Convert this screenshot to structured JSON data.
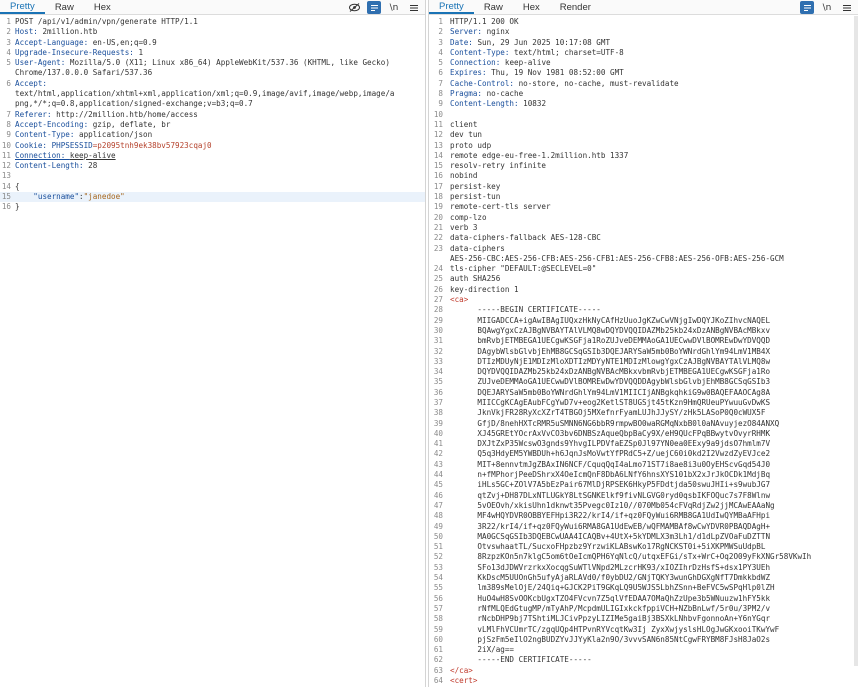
{
  "request": {
    "tabs": [
      "Pretty",
      "Raw",
      "Hex"
    ],
    "active_tab": "Pretty",
    "lines": [
      {
        "n": "1",
        "parts": [
          {
            "t": "POST /api/v1/admin/vpn/generate HTTP/1.1",
            "c": "hv"
          }
        ]
      },
      {
        "n": "2",
        "parts": [
          {
            "t": "Host: ",
            "c": "hk"
          },
          {
            "t": "2million.htb",
            "c": "hv"
          }
        ]
      },
      {
        "n": "3",
        "parts": [
          {
            "t": "Accept-Language: ",
            "c": "hk"
          },
          {
            "t": "en-US,en;q=0.9",
            "c": "hv"
          }
        ]
      },
      {
        "n": "4",
        "parts": [
          {
            "t": "Upgrade-Insecure-Requests: ",
            "c": "hk"
          },
          {
            "t": "1",
            "c": "hv"
          }
        ]
      },
      {
        "n": "5",
        "parts": [
          {
            "t": "User-Agent: ",
            "c": "hk"
          },
          {
            "t": "Mozilla/5.0 (X11; Linux x86_64) AppleWebKit/537.36 (KHTML, like Gecko)",
            "c": "hv"
          }
        ]
      },
      {
        "n": "",
        "parts": [
          {
            "t": "Chrome/137.0.0.0 Safari/537.36",
            "c": "hv"
          }
        ]
      },
      {
        "n": "6",
        "parts": [
          {
            "t": "Accept:",
            "c": "hk"
          }
        ]
      },
      {
        "n": "",
        "parts": [
          {
            "t": "text/html,application/xhtml+xml,application/xml;q=0.9,image/avif,image/webp,image/a",
            "c": "hv"
          }
        ]
      },
      {
        "n": "",
        "parts": [
          {
            "t": "png,*/*;q=0.8,application/signed-exchange;v=b3;q=0.7",
            "c": "hv"
          }
        ]
      },
      {
        "n": "7",
        "parts": [
          {
            "t": "Referer: ",
            "c": "hk"
          },
          {
            "t": "http://2million.htb/home/access",
            "c": "hv"
          }
        ]
      },
      {
        "n": "8",
        "parts": [
          {
            "t": "Accept-Encoding: ",
            "c": "hk"
          },
          {
            "t": "gzip, deflate, br",
            "c": "hv"
          }
        ]
      },
      {
        "n": "9",
        "parts": [
          {
            "t": "Content-Type: ",
            "c": "hk"
          },
          {
            "t": "application/json",
            "c": "hv"
          }
        ]
      },
      {
        "n": "10",
        "parts": [
          {
            "t": "Cookie: ",
            "c": "hk"
          },
          {
            "t": "PHPSESSID",
            "c": "hk"
          },
          {
            "t": "=p2095tnh9ek38bv57923cqaj0",
            "c": "cookie-v"
          }
        ]
      },
      {
        "n": "11",
        "parts": [
          {
            "t": "Connection: ",
            "c": "hk under"
          },
          {
            "t": "keep-alive",
            "c": "hv under"
          }
        ]
      },
      {
        "n": "12",
        "parts": [
          {
            "t": "Content-Length: ",
            "c": "hk"
          },
          {
            "t": "28",
            "c": "hv"
          }
        ]
      },
      {
        "n": "13",
        "parts": [
          {
            "t": "",
            "c": "hv"
          }
        ]
      },
      {
        "n": "14",
        "parts": [
          {
            "t": "{",
            "c": "hv"
          }
        ]
      },
      {
        "n": "15",
        "hl": true,
        "parts": [
          {
            "t": "    ",
            "c": "hv"
          },
          {
            "t": "\"username\"",
            "c": "hk"
          },
          {
            "t": ":",
            "c": "hv"
          },
          {
            "t": "\"janedoe\"",
            "c": "str"
          }
        ]
      },
      {
        "n": "16",
        "parts": [
          {
            "t": "}",
            "c": "hv"
          }
        ]
      }
    ]
  },
  "response": {
    "tabs": [
      "Pretty",
      "Raw",
      "Hex",
      "Render"
    ],
    "active_tab": "Pretty",
    "lines": [
      {
        "n": "1",
        "parts": [
          {
            "t": "HTTP/1.1 200 OK",
            "c": "hv"
          }
        ]
      },
      {
        "n": "2",
        "parts": [
          {
            "t": "Server: ",
            "c": "hk"
          },
          {
            "t": "nginx",
            "c": "hv"
          }
        ]
      },
      {
        "n": "3",
        "parts": [
          {
            "t": "Date: ",
            "c": "hk"
          },
          {
            "t": "Sun, 29 Jun 2025 10:17:08 GMT",
            "c": "hv"
          }
        ]
      },
      {
        "n": "4",
        "parts": [
          {
            "t": "Content-Type: ",
            "c": "hk"
          },
          {
            "t": "text/html; charset=UTF-8",
            "c": "hv"
          }
        ]
      },
      {
        "n": "5",
        "parts": [
          {
            "t": "Connection: ",
            "c": "hk"
          },
          {
            "t": "keep-alive",
            "c": "hv"
          }
        ]
      },
      {
        "n": "6",
        "parts": [
          {
            "t": "Expires: ",
            "c": "hk"
          },
          {
            "t": "Thu, 19 Nov 1981 08:52:00 GMT",
            "c": "hv"
          }
        ]
      },
      {
        "n": "7",
        "parts": [
          {
            "t": "Cache-Control: ",
            "c": "hk"
          },
          {
            "t": "no-store, no-cache, must-revalidate",
            "c": "hv"
          }
        ]
      },
      {
        "n": "8",
        "parts": [
          {
            "t": "Pragma: ",
            "c": "hk"
          },
          {
            "t": "no-cache",
            "c": "hv"
          }
        ]
      },
      {
        "n": "9",
        "parts": [
          {
            "t": "Content-Length: ",
            "c": "hk"
          },
          {
            "t": "10832",
            "c": "hv"
          }
        ]
      },
      {
        "n": "10",
        "parts": [
          {
            "t": "",
            "c": "hv"
          }
        ]
      },
      {
        "n": "11",
        "parts": [
          {
            "t": "client",
            "c": "hv"
          }
        ]
      },
      {
        "n": "12",
        "parts": [
          {
            "t": "dev tun",
            "c": "hv"
          }
        ]
      },
      {
        "n": "13",
        "parts": [
          {
            "t": "proto udp",
            "c": "hv"
          }
        ]
      },
      {
        "n": "14",
        "parts": [
          {
            "t": "remote edge-eu-free-1.2million.htb 1337",
            "c": "hv"
          }
        ]
      },
      {
        "n": "15",
        "parts": [
          {
            "t": "resolv-retry infinite",
            "c": "hv"
          }
        ]
      },
      {
        "n": "16",
        "parts": [
          {
            "t": "nobind",
            "c": "hv"
          }
        ]
      },
      {
        "n": "17",
        "parts": [
          {
            "t": "persist-key",
            "c": "hv"
          }
        ]
      },
      {
        "n": "18",
        "parts": [
          {
            "t": "persist-tun",
            "c": "hv"
          }
        ]
      },
      {
        "n": "19",
        "parts": [
          {
            "t": "remote-cert-tls server",
            "c": "hv"
          }
        ]
      },
      {
        "n": "20",
        "parts": [
          {
            "t": "comp-lzo",
            "c": "hv"
          }
        ]
      },
      {
        "n": "21",
        "parts": [
          {
            "t": "verb 3",
            "c": "hv"
          }
        ]
      },
      {
        "n": "22",
        "parts": [
          {
            "t": "data-ciphers-fallback AES-128-CBC",
            "c": "hv"
          }
        ]
      },
      {
        "n": "23",
        "parts": [
          {
            "t": "data-ciphers",
            "c": "hv"
          }
        ]
      },
      {
        "n": "",
        "parts": [
          {
            "t": "AES-256-CBC:AES-256-CFB:AES-256-CFB1:AES-256-CFB8:AES-256-OFB:AES-256-GCM",
            "c": "hv"
          }
        ]
      },
      {
        "n": "24",
        "parts": [
          {
            "t": "tls-cipher \"DEFAULT:@SECLEVEL=0\"",
            "c": "hv"
          }
        ]
      },
      {
        "n": "25",
        "parts": [
          {
            "t": "auth SHA256",
            "c": "hv"
          }
        ]
      },
      {
        "n": "26",
        "parts": [
          {
            "t": "key-direction 1",
            "c": "hv"
          }
        ]
      },
      {
        "n": "27",
        "parts": [
          {
            "t": "<ca>",
            "c": "tag"
          }
        ]
      },
      {
        "n": "28",
        "parts": [
          {
            "t": "      -----BEGIN CERTIFICATE-----",
            "c": "hv"
          }
        ]
      },
      {
        "n": "29",
        "parts": [
          {
            "t": "      MIIGADCCA+igAwIBAgIUQxzHkNyCAfHzUuoJgKZwCwVNjgIwDQYJKoZIhvcNAQEL",
            "c": "hv"
          }
        ]
      },
      {
        "n": "30",
        "parts": [
          {
            "t": "      BQAwgYgxCzAJBgNVBAYTAlVLMQ8wDQYDVQQIDAZMb25kb24xDzANBgNVBAcMBkxv",
            "c": "hv"
          }
        ]
      },
      {
        "n": "31",
        "parts": [
          {
            "t": "      bmRvbjETMBEGA1UECgwKSGFja1RoZUJveDEMMAoGA1UECwwDVlBOMREwDwYDVQQD",
            "c": "hv"
          }
        ]
      },
      {
        "n": "32",
        "parts": [
          {
            "t": "      DAgybWlsbGlvbjEhMB8GCSqGSIb3DQEJARYSaW5mb0BoYWNrdGhlYm94LmV1MB4X",
            "c": "hv"
          }
        ]
      },
      {
        "n": "33",
        "parts": [
          {
            "t": "      DTIzMDUyNjE1MDIzMloXDTIzMDYyNTE1MDIzMlowgYgxCzAJBgNVBAYTAlVLMQ8w",
            "c": "hv"
          }
        ]
      },
      {
        "n": "34",
        "parts": [
          {
            "t": "      DQYDVQQIDAZMb25kb24xDzANBgNVBAcMBkxvbmRvbjETMBEGA1UECgwKSGFja1Ro",
            "c": "hv"
          }
        ]
      },
      {
        "n": "35",
        "parts": [
          {
            "t": "      ZUJveDEMMAoGA1UECwwDVlBOMREwDwYDVQQDDAgybWlsbGlvbjEhMB8GCSqGSIb3",
            "c": "hv"
          }
        ]
      },
      {
        "n": "36",
        "parts": [
          {
            "t": "      DQEJARYSaW5mb0BoYWNrdGhlYm94LmV1MIICIjANBgkqhkiG9w0BAQEFAAOCAg8A",
            "c": "hv"
          }
        ]
      },
      {
        "n": "37",
        "parts": [
          {
            "t": "      MIICCgKCAgEAubFCgYwD7v+eog2KetlST8UGSjt45tKzn9HmQRUeuPYwuuGvDwKS",
            "c": "hv"
          }
        ]
      },
      {
        "n": "38",
        "parts": [
          {
            "t": "      JknVkjFR28RyXcXZrT4TBGOj5MXefnrFyamLUJhJJySY/zHk5LASoP0Q0cWUX5F",
            "c": "hv"
          }
        ]
      },
      {
        "n": "39",
        "parts": [
          {
            "t": "      GfjD/8nehHXTcRMR5uSMNN6NG6bbR9rmpwBO0waRGMqNxbB0l0aNAvuyjezO84ANXQ",
            "c": "hv"
          }
        ]
      },
      {
        "n": "40",
        "parts": [
          {
            "t": "      XJ45GREtYOcrAxVvCO3bv6DNBSzAqueQbpBaCy9X/eH9QUcFPqBBwytvOvyrRHMK",
            "c": "hv"
          }
        ]
      },
      {
        "n": "41",
        "parts": [
          {
            "t": "      DXJtZxP35WcswO3gnds9YhvgILPDVfaEZSp0Jl97YN0ea0EExy9a9jdsO7hmlm7V",
            "c": "hv"
          }
        ]
      },
      {
        "n": "42",
        "parts": [
          {
            "t": "      Q5q3HdyEM5YWBDUh+h6JqnJsMoVwtYfPRdC5+Z/uejC60i0kd2I2VwzdZyEVJce2",
            "c": "hv"
          }
        ]
      },
      {
        "n": "43",
        "parts": [
          {
            "t": "      MIT+8ennvtmJgZBAxIN6NCF/CquqQqI4aLmo71ST7i8ae8i3u0OyEHScvGqd54J0",
            "c": "hv"
          }
        ]
      },
      {
        "n": "44",
        "parts": [
          {
            "t": "      n+fMPhorjPeeDShrxX4OeIcmQnF8DbA6LNfY6hnsXYS101bX2xJrJkOCDk1MdjBq",
            "c": "hv"
          }
        ]
      },
      {
        "n": "45",
        "parts": [
          {
            "t": "      iHLs5GC+ZOlV7A5bEzPair67MlDjRPSEK6HkyP5FDdtjda50swuJHIi+s9wubJG7",
            "c": "hv"
          }
        ]
      },
      {
        "n": "46",
        "parts": [
          {
            "t": "      qtZvj+DH87DLxNTLUGkY8LtSGNKElkf9fivNLGVG0ryd0qsbIKFOQuc7s7F8Wlnw",
            "c": "hv"
          }
        ]
      },
      {
        "n": "47",
        "parts": [
          {
            "t": "      5vOEOvh/xkisUhn1dknwt35Pvegc0Iz10//070Mb054cFVqRdjZw2jjMCAwEAAaNg",
            "c": "hv"
          }
        ]
      },
      {
        "n": "48",
        "parts": [
          {
            "t": "      MF4wHQYDVR0OBBYEFHpi3R22/krI4/if+qz0FQyWui6RMB8GA1UdIwQYMBaAFHpi",
            "c": "hv"
          }
        ]
      },
      {
        "n": "49",
        "parts": [
          {
            "t": "      3R22/krI4/if+qz0FQyWui6RMA8GA1UdEwEB/wQFMAMBAf8wCwYDVR0PBAQDAgH+",
            "c": "hv"
          }
        ]
      },
      {
        "n": "50",
        "parts": [
          {
            "t": "      MA0GCSqGSIb3DQEBCwUAA4ICAQBv+4UtX+5kYDMLX3m3Lh1/d1dLpZVOaFuDZTTN",
            "c": "hv"
          }
        ]
      },
      {
        "n": "51",
        "parts": [
          {
            "t": "      OtvswhaatTL/SucxoFHpzbz9YrzwiKLABswKo17RgNCKST0i+5iXKPMWSuUdpBL",
            "c": "hv"
          }
        ]
      },
      {
        "n": "52",
        "parts": [
          {
            "t": "      8RzpzKOn5n7klgC5om6tOeIcmQPH6YqNlcQ/utqxEFGi/sTx+WrC+Oq2O09yFkXNGr58VKwIh",
            "c": "hv"
          }
        ]
      },
      {
        "n": "53",
        "parts": [
          {
            "t": "      SFo13dJDWVrzrkxXocqgSuWTlVNpd2MLzcrHK93/xIOZIhrDzHsfS+dsx1PY3UEh",
            "c": "hv"
          }
        ]
      },
      {
        "n": "54",
        "parts": [
          {
            "t": "      KkDscM5UUOnGh5ufyAjaRLAVd0/f0ybDU2/GNjTQKY3wunGhDGXgNfT7DmkkbdWZ",
            "c": "hv"
          }
        ]
      },
      {
        "n": "55",
        "parts": [
          {
            "t": "      lm389sMelOjE/24Qiq+GJCK2PiT9GKqLQ9U5WJS5LbhZSnn+BeFVC5wSPqHlp0lZH",
            "c": "hv"
          }
        ]
      },
      {
        "n": "56",
        "parts": [
          {
            "t": "      HuO4wH8SvOOKcbUgxTZO4FVcvn7Z5qlVfEDAA7OMaQhZzUpe3b5WNuuzw1hFY5kk",
            "c": "hv"
          }
        ]
      },
      {
        "n": "57",
        "parts": [
          {
            "t": "      rNfMLQEdGtugMP/mTyAhP/McpdmULIGIxkckfppiVCH+NZbBnLwf/5r0u/3PM2/v",
            "c": "hv"
          }
        ]
      },
      {
        "n": "58",
        "parts": [
          {
            "t": "      rNcbDHP9bj7TShtiMLJCivPpzyLIZIMe5gaiBj3BSXkLNhbvFgonnoAn+Y6nYGqr",
            "c": "hv"
          }
        ]
      },
      {
        "n": "59",
        "parts": [
          {
            "t": "      vLMlFhVCUmrTC/zgqUQp4HTPvnRYVcqtKw3Ij ZyxXwjyslsHLOgJwGKxooiTKwYwF",
            "c": "hv"
          }
        ]
      },
      {
        "n": "60",
        "parts": [
          {
            "t": "      pjSzFm5eIlO2ngBUDZYvJJYyKla2n9O/3vvvSAN6n85NtCgwFRYBM8FJsH8JaO2s",
            "c": "hv"
          }
        ]
      },
      {
        "n": "61",
        "parts": [
          {
            "t": "      2iX/ag==",
            "c": "hv"
          }
        ]
      },
      {
        "n": "62",
        "parts": [
          {
            "t": "      -----END CERTIFICATE-----",
            "c": "hv"
          }
        ]
      },
      {
        "n": "63",
        "parts": [
          {
            "t": "</ca>",
            "c": "tag"
          }
        ]
      },
      {
        "n": "64",
        "parts": [
          {
            "t": "<cert>",
            "c": "tag"
          }
        ]
      }
    ]
  },
  "icons": {
    "hide": "eye-slash-icon",
    "wrap": "wrap-lines-icon",
    "newline": "\\n",
    "menu": "menu-icon"
  },
  "colors": {
    "accent": "#1a73b5",
    "header_key": "#1a4f9c",
    "cookie_value": "#b5422c",
    "json_string": "#a6661c",
    "tag": "#c0392b"
  }
}
